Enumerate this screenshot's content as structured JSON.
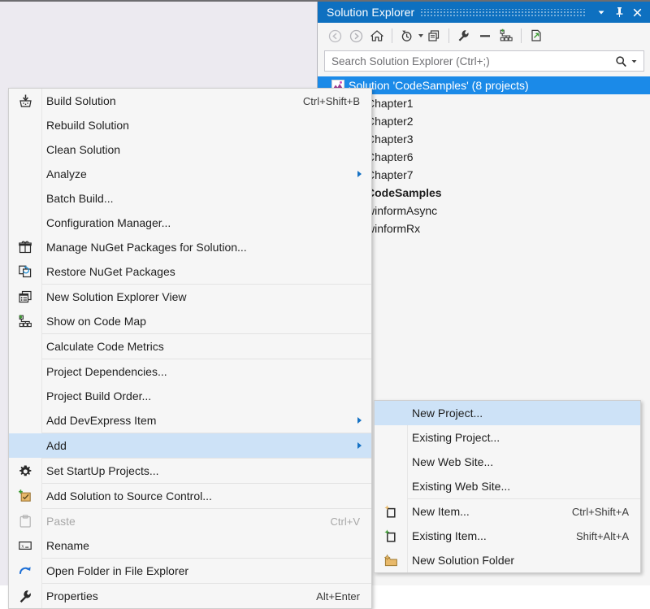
{
  "colors": {
    "title_bar": "#0e70c0",
    "tree_selection": "#1b8ae8",
    "menu_highlight": "#cde2f7",
    "menu_background": "#f6f6f6",
    "app_background": "#eeeef2",
    "submenu_arrow": "#1672c4"
  },
  "solution_explorer": {
    "title": "Solution Explorer",
    "title_buttons": [
      {
        "name": "dropdown",
        "glyph": "▾"
      },
      {
        "name": "pin",
        "glyph": "⚐"
      },
      {
        "name": "close",
        "glyph": "✕"
      }
    ],
    "toolbar": [
      {
        "name": "back",
        "tooltip": "Back"
      },
      {
        "name": "forward",
        "tooltip": "Forward"
      },
      {
        "name": "home",
        "tooltip": "Home"
      },
      {
        "name": "pending-changes-filter",
        "tooltip": "Pending Changes Filter"
      },
      {
        "name": "sync-with-active-document",
        "tooltip": "Sync with Active Document"
      },
      {
        "name": "properties",
        "tooltip": "Properties"
      },
      {
        "name": "collapse-all",
        "tooltip": "Collapse All"
      },
      {
        "name": "show-all-files",
        "tooltip": "Show All Files"
      },
      {
        "name": "preview-selected-items",
        "tooltip": "Preview Selected Items"
      }
    ],
    "search": {
      "placeholder": "Search Solution Explorer (Ctrl+;)",
      "value": ""
    },
    "tree": {
      "root": {
        "label": "Solution 'CodeSamples' (8 projects)",
        "selected": true,
        "icon": "solution-icon"
      },
      "children": [
        {
          "label": "Chapter1",
          "bold": false,
          "expander": false
        },
        {
          "label": "Chapter2",
          "bold": false,
          "expander": false
        },
        {
          "label": "Chapter3",
          "bold": false,
          "expander": false
        },
        {
          "label": "Chapter6",
          "bold": false,
          "expander": false
        },
        {
          "label": "Chapter7",
          "bold": false,
          "expander": true
        },
        {
          "label": "CodeSamples",
          "bold": true,
          "expander": false
        },
        {
          "label": "winformAsync",
          "bold": false,
          "expander": false
        },
        {
          "label": "winformRx",
          "bold": false,
          "expander": false
        }
      ]
    }
  },
  "context_menu": {
    "items": [
      {
        "label": "Build Solution",
        "shortcut": "Ctrl+Shift+B",
        "icon": "build-solution-icon",
        "submenu": false,
        "separator_after": false,
        "disabled": false,
        "selected": false
      },
      {
        "label": "Rebuild Solution",
        "shortcut": "",
        "icon": "",
        "submenu": false,
        "separator_after": false,
        "disabled": false,
        "selected": false
      },
      {
        "label": "Clean Solution",
        "shortcut": "",
        "icon": "",
        "submenu": false,
        "separator_after": false,
        "disabled": false,
        "selected": false
      },
      {
        "label": "Analyze",
        "shortcut": "",
        "icon": "",
        "submenu": true,
        "separator_after": false,
        "disabled": false,
        "selected": false
      },
      {
        "label": "Batch Build...",
        "shortcut": "",
        "icon": "",
        "submenu": false,
        "separator_after": false,
        "disabled": false,
        "selected": false
      },
      {
        "label": "Configuration Manager...",
        "shortcut": "",
        "icon": "",
        "submenu": false,
        "separator_after": false,
        "disabled": false,
        "selected": false
      },
      {
        "label": "Manage NuGet Packages for Solution...",
        "shortcut": "",
        "icon": "nuget-manage-icon",
        "submenu": false,
        "separator_after": false,
        "disabled": false,
        "selected": false
      },
      {
        "label": "Restore NuGet Packages",
        "shortcut": "",
        "icon": "nuget-restore-icon",
        "submenu": false,
        "separator_after": true,
        "disabled": false,
        "selected": false
      },
      {
        "label": "New Solution Explorer View",
        "shortcut": "",
        "icon": "new-solution-explorer-view-icon",
        "submenu": false,
        "separator_after": false,
        "disabled": false,
        "selected": false
      },
      {
        "label": "Show on Code Map",
        "shortcut": "",
        "icon": "code-map-icon",
        "submenu": false,
        "separator_after": true,
        "disabled": false,
        "selected": false
      },
      {
        "label": "Calculate Code Metrics",
        "shortcut": "",
        "icon": "",
        "submenu": false,
        "separator_after": true,
        "disabled": false,
        "selected": false
      },
      {
        "label": "Project Dependencies...",
        "shortcut": "",
        "icon": "",
        "submenu": false,
        "separator_after": false,
        "disabled": false,
        "selected": false
      },
      {
        "label": "Project Build Order...",
        "shortcut": "",
        "icon": "",
        "submenu": false,
        "separator_after": false,
        "disabled": false,
        "selected": false
      },
      {
        "label": "Add DevExpress Item",
        "shortcut": "",
        "icon": "",
        "submenu": true,
        "separator_after": true,
        "disabled": false,
        "selected": false
      },
      {
        "label": "Add",
        "shortcut": "",
        "icon": "",
        "submenu": true,
        "separator_after": true,
        "disabled": false,
        "selected": true
      },
      {
        "label": "Set StartUp Projects...",
        "shortcut": "",
        "icon": "gear-icon",
        "submenu": false,
        "separator_after": true,
        "disabled": false,
        "selected": false
      },
      {
        "label": "Add Solution to Source Control...",
        "shortcut": "",
        "icon": "source-control-add-icon",
        "submenu": false,
        "separator_after": true,
        "disabled": false,
        "selected": false
      },
      {
        "label": "Paste",
        "shortcut": "Ctrl+V",
        "icon": "paste-icon",
        "submenu": false,
        "separator_after": false,
        "disabled": true,
        "selected": false
      },
      {
        "label": "Rename",
        "shortcut": "",
        "icon": "rename-icon",
        "submenu": false,
        "separator_after": true,
        "disabled": false,
        "selected": false
      },
      {
        "label": "Open Folder in File Explorer",
        "shortcut": "",
        "icon": "open-folder-icon",
        "submenu": false,
        "separator_after": true,
        "disabled": false,
        "selected": false
      },
      {
        "label": "Properties",
        "shortcut": "Alt+Enter",
        "icon": "wrench-icon",
        "submenu": false,
        "separator_after": false,
        "disabled": false,
        "selected": false
      }
    ]
  },
  "add_submenu": {
    "items": [
      {
        "label": "New Project...",
        "shortcut": "",
        "icon": "",
        "separator_after": false,
        "selected": true
      },
      {
        "label": "Existing Project...",
        "shortcut": "",
        "icon": "",
        "separator_after": false,
        "selected": false
      },
      {
        "label": "New Web Site...",
        "shortcut": "",
        "icon": "",
        "separator_after": false,
        "selected": false
      },
      {
        "label": "Existing Web Site...",
        "shortcut": "",
        "icon": "",
        "separator_after": true,
        "selected": false
      },
      {
        "label": "New Item...",
        "shortcut": "Ctrl+Shift+A",
        "icon": "new-item-icon",
        "separator_after": false,
        "selected": false
      },
      {
        "label": "Existing Item...",
        "shortcut": "Shift+Alt+A",
        "icon": "existing-item-icon",
        "separator_after": false,
        "selected": false
      },
      {
        "label": "New Solution Folder",
        "shortcut": "",
        "icon": "new-solution-folder-icon",
        "separator_after": false,
        "selected": false
      }
    ]
  }
}
